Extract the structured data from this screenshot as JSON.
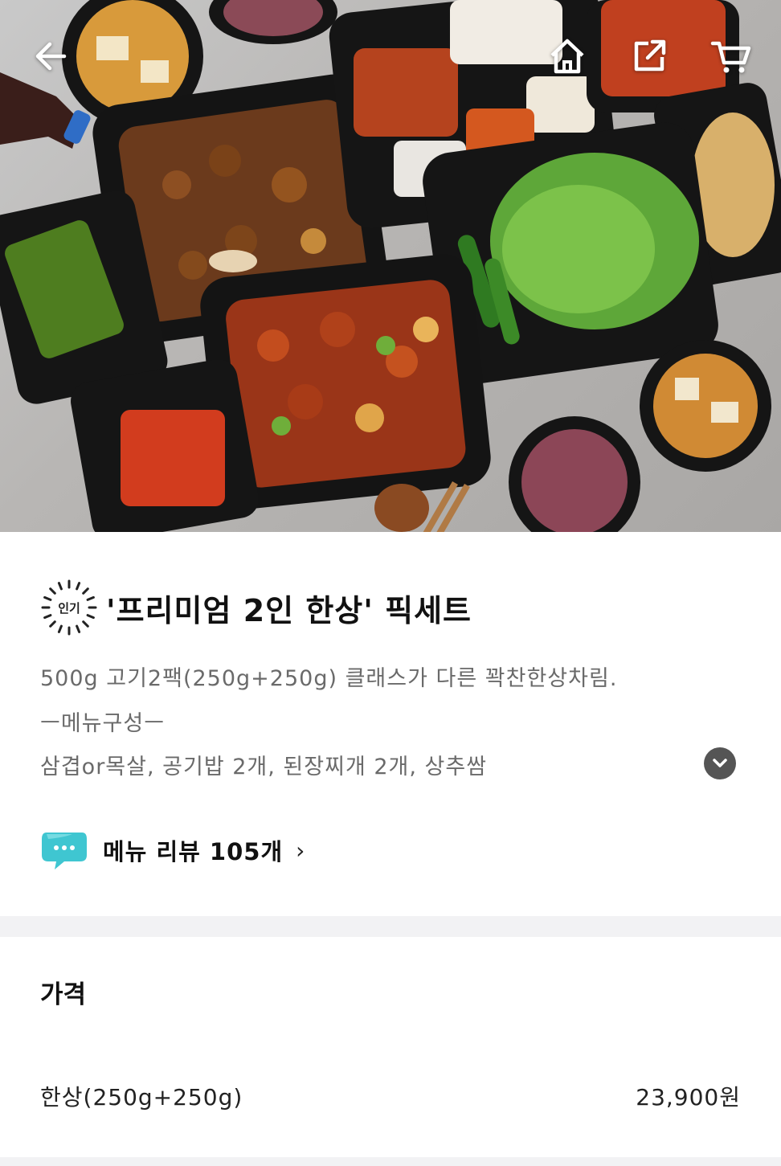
{
  "header": {
    "icons": [
      "back-arrow-icon",
      "home-icon",
      "share-icon",
      "cart-icon"
    ]
  },
  "product": {
    "badge": "인기",
    "title": "'프리미엄 2인 한상' 픽세트",
    "description_line1": "500g 고기2팩(250g+250g) 클래스가 다른 꽉찬한상차림.",
    "description_line2": "ㅡ메뉴구성ㅡ",
    "description_line3": "삼겹or목살, 공기밥 2개, 된장찌개 2개, 상추쌈",
    "review_label": "메뉴 리뷰 105개",
    "review_chevron": "›"
  },
  "price": {
    "heading": "가격",
    "options": [
      {
        "name": "한상(250g+250g)",
        "amount": "23,900원"
      }
    ]
  },
  "colors": {
    "accent_bubble": "#3fc6d1",
    "expand_button": "#555555",
    "divider": "#f2f2f4"
  }
}
